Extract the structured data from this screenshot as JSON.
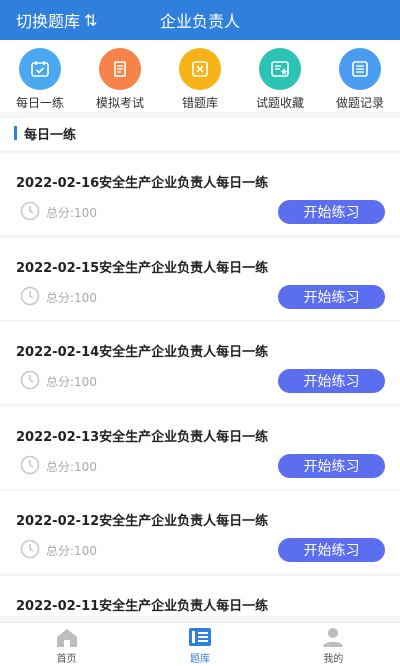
{
  "header": {
    "switch_label": "切换题库",
    "title": "企业负责人"
  },
  "shortcuts": [
    {
      "label": "每日一练",
      "icon": "calendar-check-icon",
      "color": "#4aa8f0"
    },
    {
      "label": "模拟考试",
      "icon": "exam-paper-icon",
      "color": "#f5834a"
    },
    {
      "label": "错题库",
      "icon": "wrong-book-icon",
      "color": "#f6b318"
    },
    {
      "label": "试题收藏",
      "icon": "favorite-list-icon",
      "color": "#2dc3b4"
    },
    {
      "label": "做题记录",
      "icon": "record-list-icon",
      "color": "#4a9cf0"
    }
  ],
  "section": {
    "title": "每日一练"
  },
  "practice_items": [
    {
      "title": "2022-02-16安全生产企业负责人每日一练",
      "score": "总分:100",
      "button": "开始练习"
    },
    {
      "title": "2022-02-15安全生产企业负责人每日一练",
      "score": "总分:100",
      "button": "开始练习"
    },
    {
      "title": "2022-02-14安全生产企业负责人每日一练",
      "score": "总分:100",
      "button": "开始练习"
    },
    {
      "title": "2022-02-13安全生产企业负责人每日一练",
      "score": "总分:100",
      "button": "开始练习"
    },
    {
      "title": "2022-02-12安全生产企业负责人每日一练",
      "score": "总分:100",
      "button": "开始练习"
    },
    {
      "title": "2022-02-11安全生产企业负责人每日一练"
    }
  ],
  "tabs": [
    {
      "label": "首页",
      "icon": "home-icon"
    },
    {
      "label": "题库",
      "icon": "question-bank-icon",
      "active": true
    },
    {
      "label": "我的",
      "icon": "user-icon"
    }
  ],
  "colors": {
    "primary": "#2f7fdc",
    "button": "#5b6ef0"
  }
}
